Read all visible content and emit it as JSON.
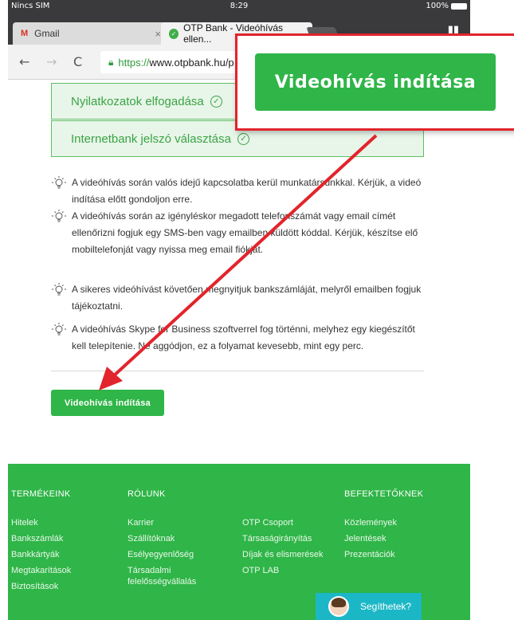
{
  "status_bar": {
    "carrier": "Nincs SIM",
    "time": "8:29",
    "battery": "100%"
  },
  "tabs": [
    {
      "label": "Gmail",
      "favicon": "gmail-icon"
    },
    {
      "label": "OTP Bank - Videóhívás ellen..."
    }
  ],
  "address": {
    "https": "https://",
    "domain": "www.otpbank.hu/p"
  },
  "steps": [
    {
      "label": "Nyilatkozatok elfogadása"
    },
    {
      "label": "Internetbank jelszó választása"
    }
  ],
  "tips": [
    "A videóhívás során valós idejű kapcsolatba kerül munkatársunkkal. Kérjük, a videó indítása előtt gondoljon erre.",
    "A videóhívás során az igényléskor megadott telefonszámát vagy email címét ellenőrizni fogjuk egy SMS-ben vagy emailben küldött kóddal. Kérjük, készítse elő mobiltelefonját vagy nyissa meg email fiókját.",
    "A sikeres videóhívást követően megnyitjuk bankszámláját, melyről emailben fogjuk tájékoztatni.",
    "A videóhívás Skype for Business szoftverrel fog történni, melyhez egy kiegészítőt kell telepítenie. Ne aggódjon, ez a folyamat kevesebb, mint egy perc."
  ],
  "cta_label": "Videohívás indítása",
  "callout_label": "Videohívás indítása",
  "footer": {
    "col1": {
      "heading": "TERMÉKEINK",
      "links": [
        "Hitelek",
        "Bankszámlák",
        "Bankkártyák",
        "Megtakarítások",
        "Biztosítások"
      ]
    },
    "col2": {
      "heading": "RÓLUNK",
      "links": [
        "Karrier",
        "Szállítóknak",
        "Esélyegyenlőség",
        "Társadalmi felelősségvállalás"
      ]
    },
    "col3": {
      "links": [
        "OTP Csoport",
        "Társaságirányítás",
        "Díjak és elismerések",
        "OTP LAB"
      ]
    },
    "col4": {
      "heading": "BEFEKTETŐKNEK",
      "links": [
        "Közlemények",
        "Jelentések",
        "Prezentációk"
      ]
    }
  },
  "help_label": "Segíthetek?",
  "colors": {
    "brand_green": "#2fb548",
    "callout_red": "#e2242c",
    "help_teal": "#1cb7c6"
  }
}
